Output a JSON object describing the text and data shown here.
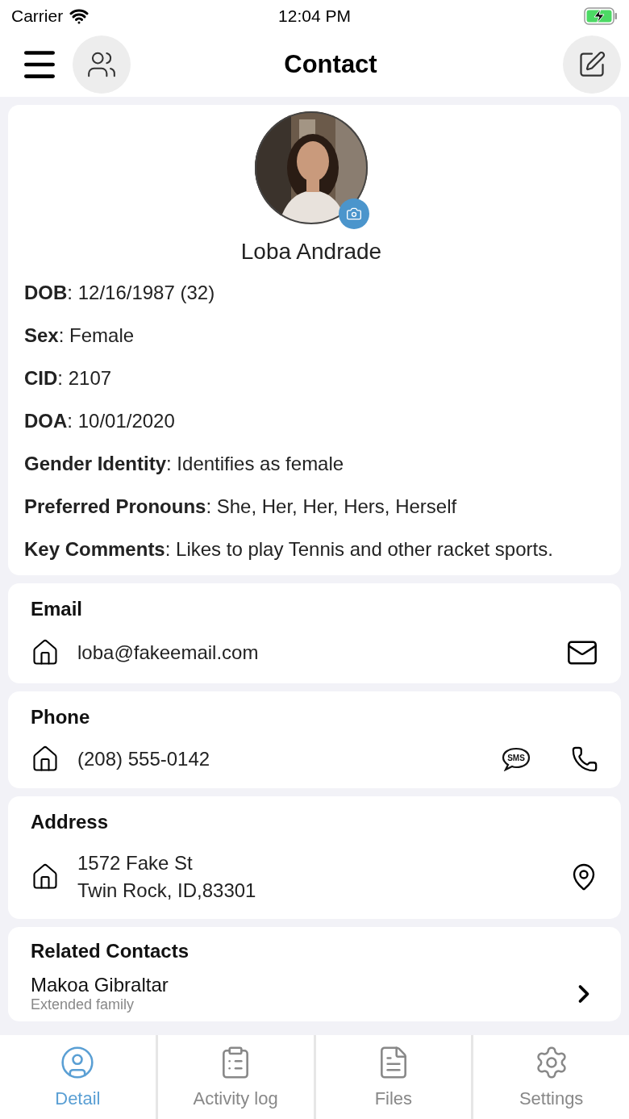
{
  "status_bar": {
    "carrier": "Carrier",
    "time": "12:04 PM",
    "charging": true
  },
  "header": {
    "title": "Contact"
  },
  "profile": {
    "name": "Loba Andrade",
    "details": [
      "**DOB**: 12/16/1987 (32)",
      "**Sex**: Female",
      "**CID**: 2107",
      "**DOA**: 10/01/2020",
      "**Gender Identity**: Identifies as female",
      "**Preferred Pronouns**: She, Her, Her, Hers, Herself",
      "**Key Comments**: Likes to play Tennis and other racket sports."
    ]
  },
  "email": {
    "title": "Email",
    "value": "loba@fakeemail.com"
  },
  "phone": {
    "title": "Phone",
    "value": "(208) 555-0142",
    "sms_label": "SMS"
  },
  "address": {
    "title": "Address",
    "lines": [
      "1572 Fake St",
      "Twin Rock, ID,83301"
    ]
  },
  "related_contacts": {
    "title": "Related Contacts",
    "items": [
      {
        "name": "Makoa Gibraltar",
        "relation": "Extended family"
      }
    ]
  },
  "tabs": [
    {
      "label": "Detail",
      "kind": "detail",
      "selected": true
    },
    {
      "label": "Activity log",
      "kind": "activity",
      "selected": false
    },
    {
      "label": "Files",
      "kind": "files",
      "selected": false
    },
    {
      "label": "Settings",
      "kind": "settings",
      "selected": false
    }
  ]
}
